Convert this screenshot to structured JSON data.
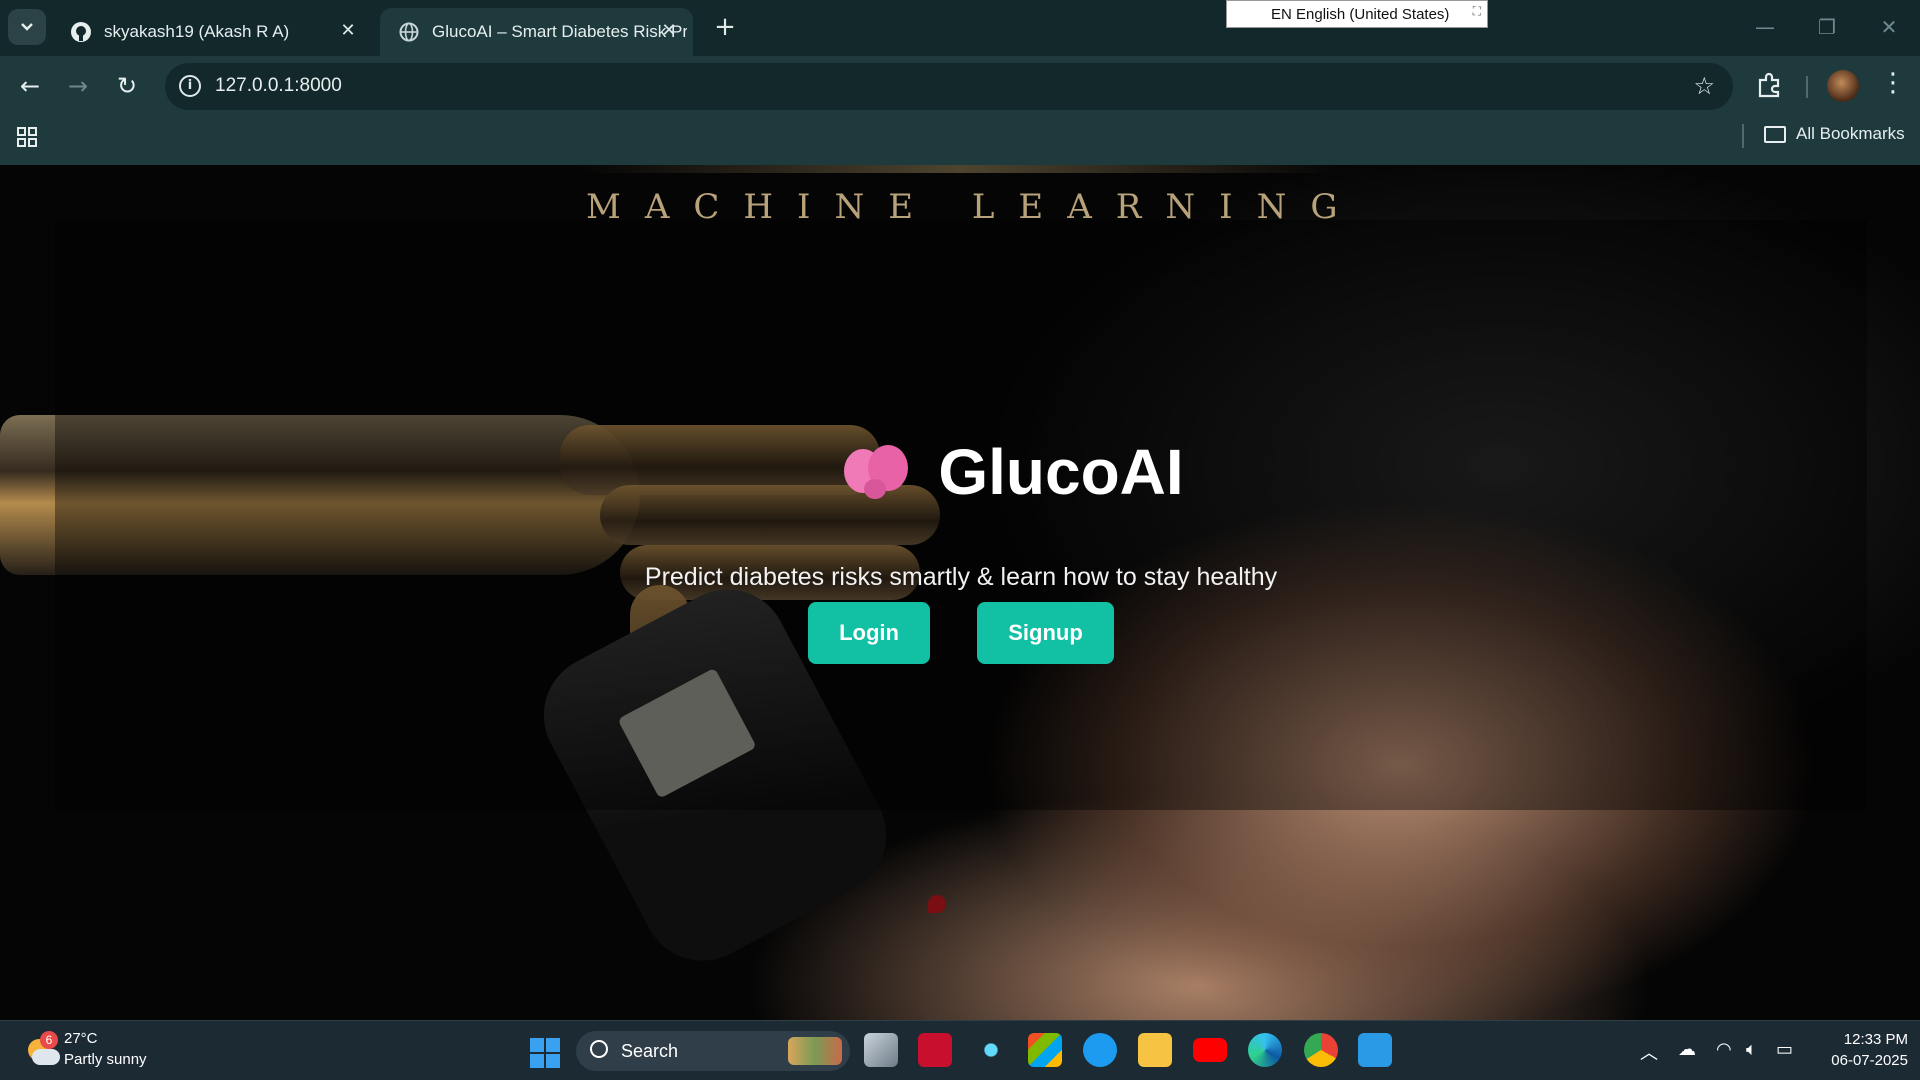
{
  "browser": {
    "tabs": [
      {
        "title": "skyakash19 (Akash R A)",
        "favicon": "github-icon"
      },
      {
        "title": "GlucoAI – Smart Diabetes Risk Predictor",
        "favicon": "globe-icon"
      }
    ],
    "url": "127.0.0.1:8000",
    "language_bar": "EN English (United States)",
    "bookmarks_label": "All Bookmarks"
  },
  "page": {
    "banner_text": "MACHINE LEARNING",
    "brand": "GlucoAI",
    "brand_icon": "brain-icon",
    "tagline": "Predict diabetes risks smartly & learn how to stay healthy",
    "buttons": {
      "login": "Login",
      "signup": "Signup"
    },
    "accent_color": "#12c1a4"
  },
  "taskbar": {
    "weather": {
      "temp": "27°C",
      "condition": "Partly sunny",
      "badge": "6"
    },
    "search_label": "Search",
    "clock": {
      "time": "12:33 PM",
      "date": "06-07-2025"
    }
  }
}
